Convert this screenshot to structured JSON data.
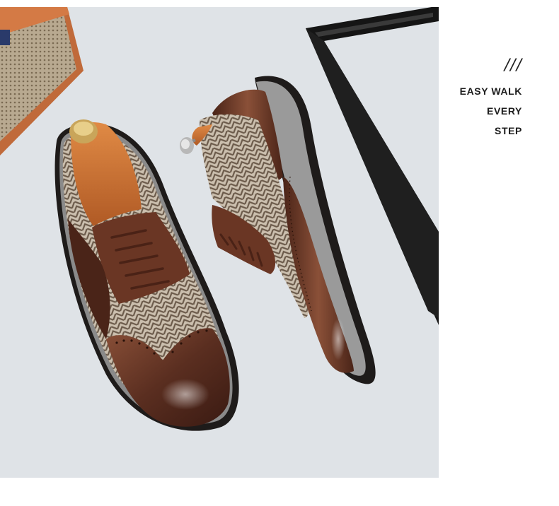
{
  "caption": {
    "slashes": "///",
    "lines": [
      "EASY WALK",
      "EVERY",
      "STEP"
    ]
  },
  "colors": {
    "backdrop": "#dfe3e7",
    "leather": "#5a2e20",
    "leather_highlight": "#8a5038",
    "tweed_light": "#cbbfae",
    "tweed_dark": "#6b5a4a",
    "sole": "#1e1b1a",
    "wood_box": "#c06a3a",
    "frame": "#1a1a1a"
  }
}
